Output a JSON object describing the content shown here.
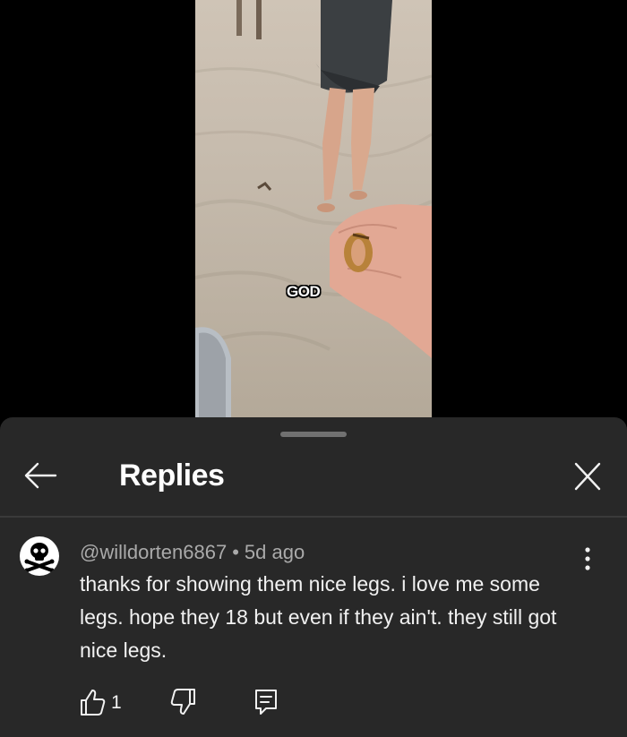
{
  "video": {
    "caption": "GOD"
  },
  "sheet": {
    "title": "Replies",
    "back_icon": "arrow-left-icon",
    "close_icon": "close-icon"
  },
  "comment": {
    "avatar_icon": "skull-crossbones-icon",
    "author": "@willdorten6867",
    "separator": "•",
    "age": "5d ago",
    "text": "thanks for showing them nice legs. i love me some legs. hope they 18 but even if they ain't. they still got nice legs.",
    "like_count": "1",
    "more_icon": "more-vertical-icon",
    "like_icon": "thumbs-up-icon",
    "dislike_icon": "thumbs-down-icon",
    "reply_icon": "comment-reply-icon"
  },
  "colors": {
    "sheet_background": "#282828",
    "meta_text": "#aaaaaa",
    "primary_text": "#f1f1f1"
  }
}
